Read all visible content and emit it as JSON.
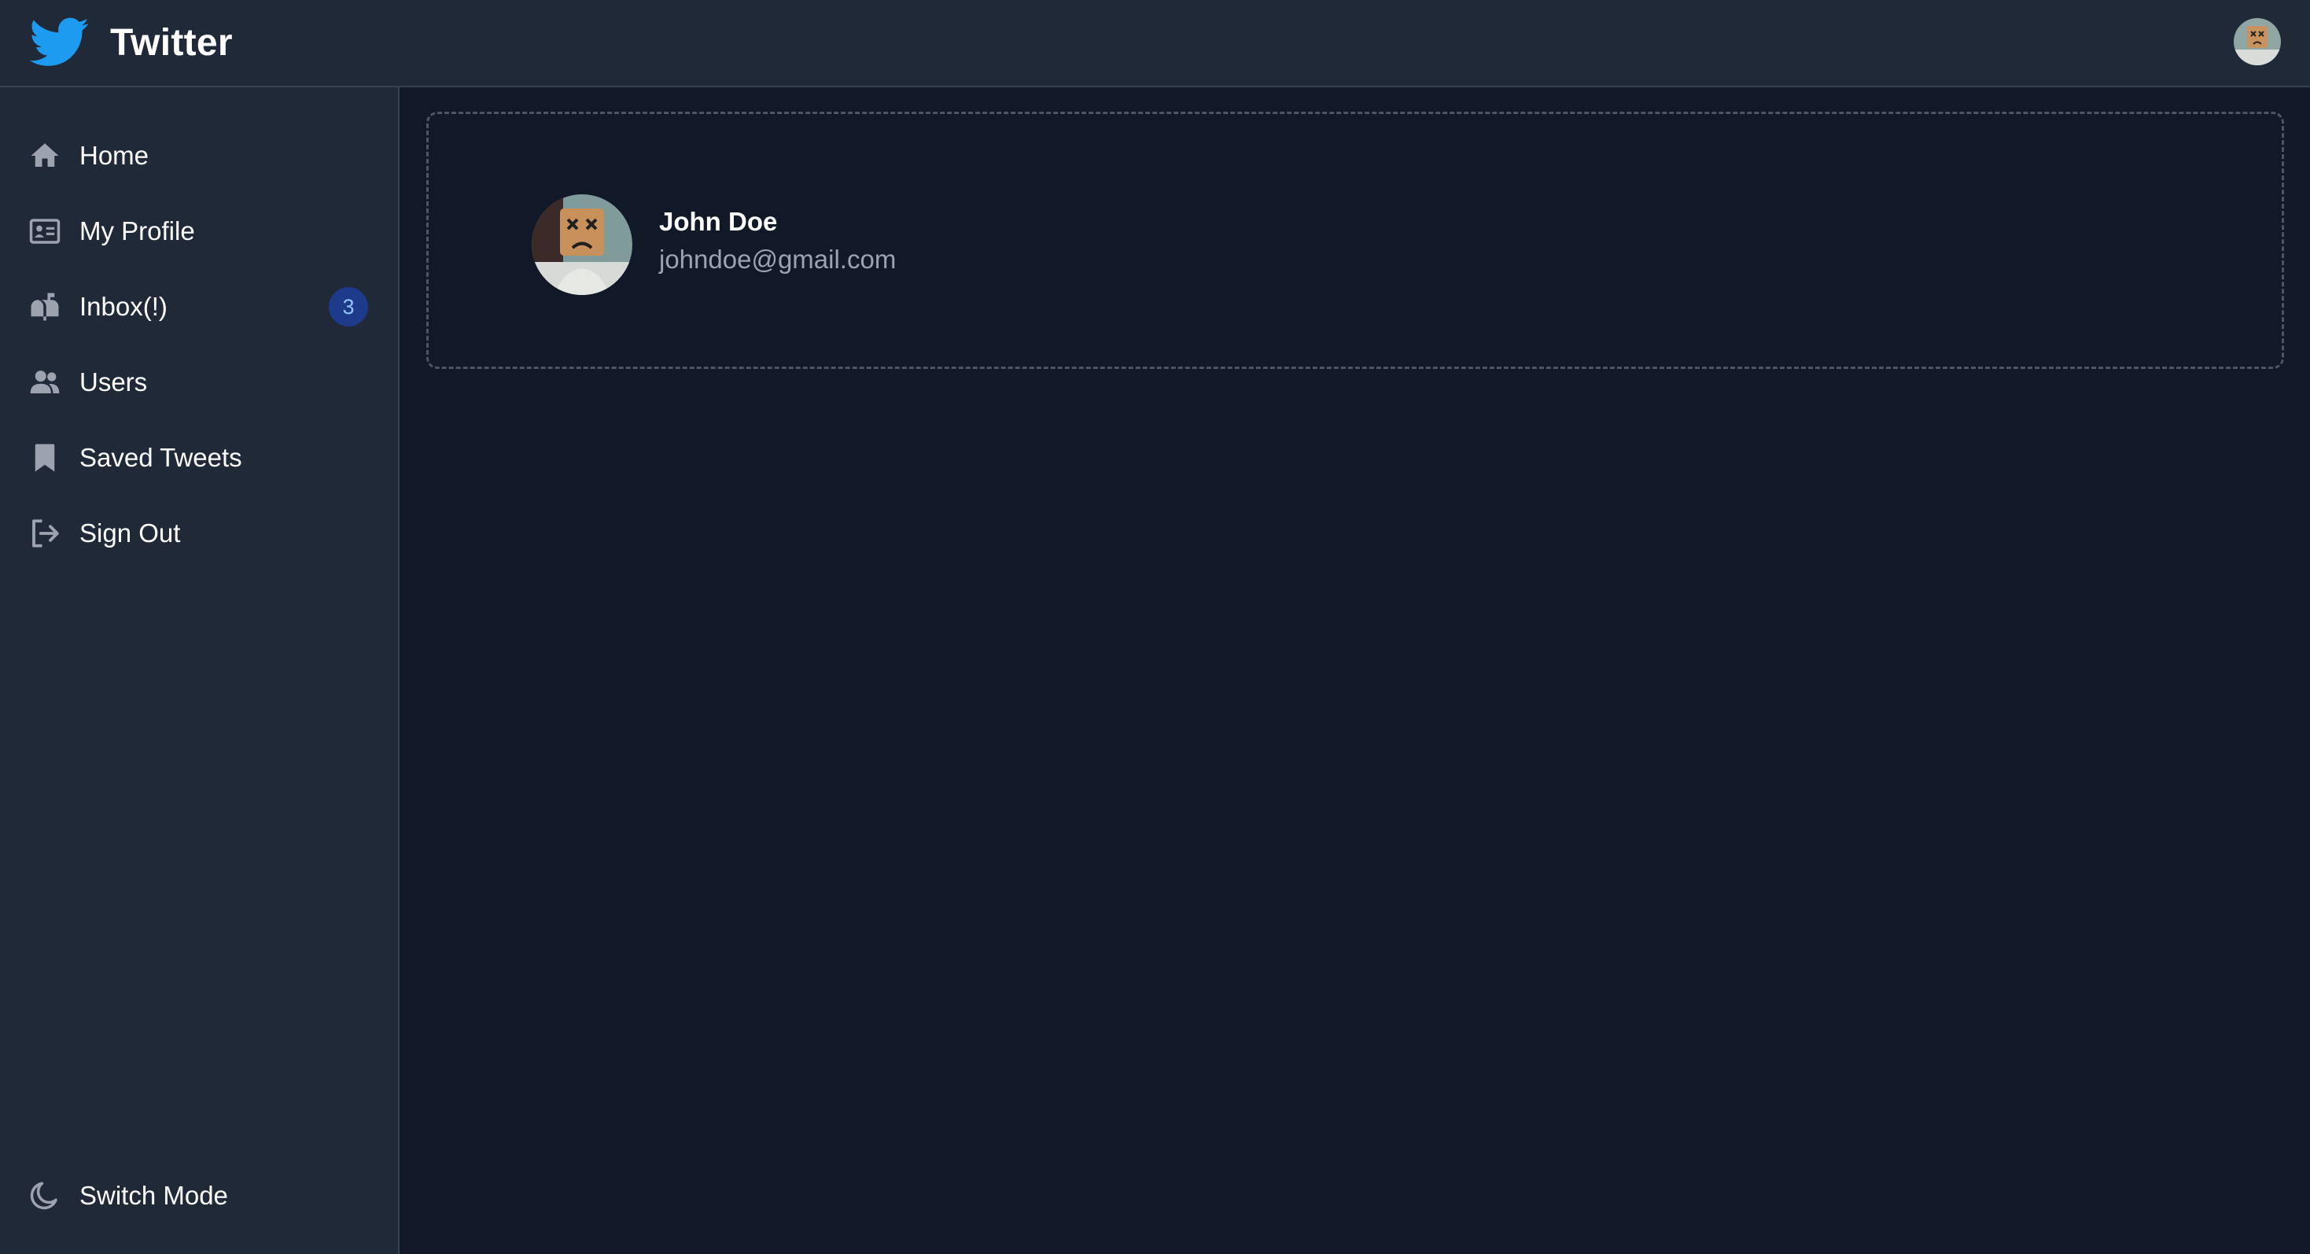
{
  "app": {
    "title": "Twitter",
    "brand_color": "#1d9bf0"
  },
  "sidebar": {
    "items": [
      {
        "label": "Home",
        "icon": "home-icon"
      },
      {
        "label": "My Profile",
        "icon": "id-card-icon"
      },
      {
        "label": "Inbox(!)",
        "icon": "mailbox-icon",
        "badge": "3"
      },
      {
        "label": "Users",
        "icon": "users-icon"
      },
      {
        "label": "Saved Tweets",
        "icon": "bookmark-icon"
      },
      {
        "label": "Sign Out",
        "icon": "sign-out-icon"
      }
    ],
    "footer": {
      "label": "Switch Mode",
      "icon": "moon-icon"
    }
  },
  "user": {
    "name": "John Doe",
    "email": "johndoe@gmail.com"
  },
  "colors": {
    "background": "#111827",
    "panel": "#1f2937",
    "border": "#374151",
    "badge_bg": "#1e3a8a",
    "badge_text": "#93c5fd",
    "muted_text": "#9ca3af"
  }
}
